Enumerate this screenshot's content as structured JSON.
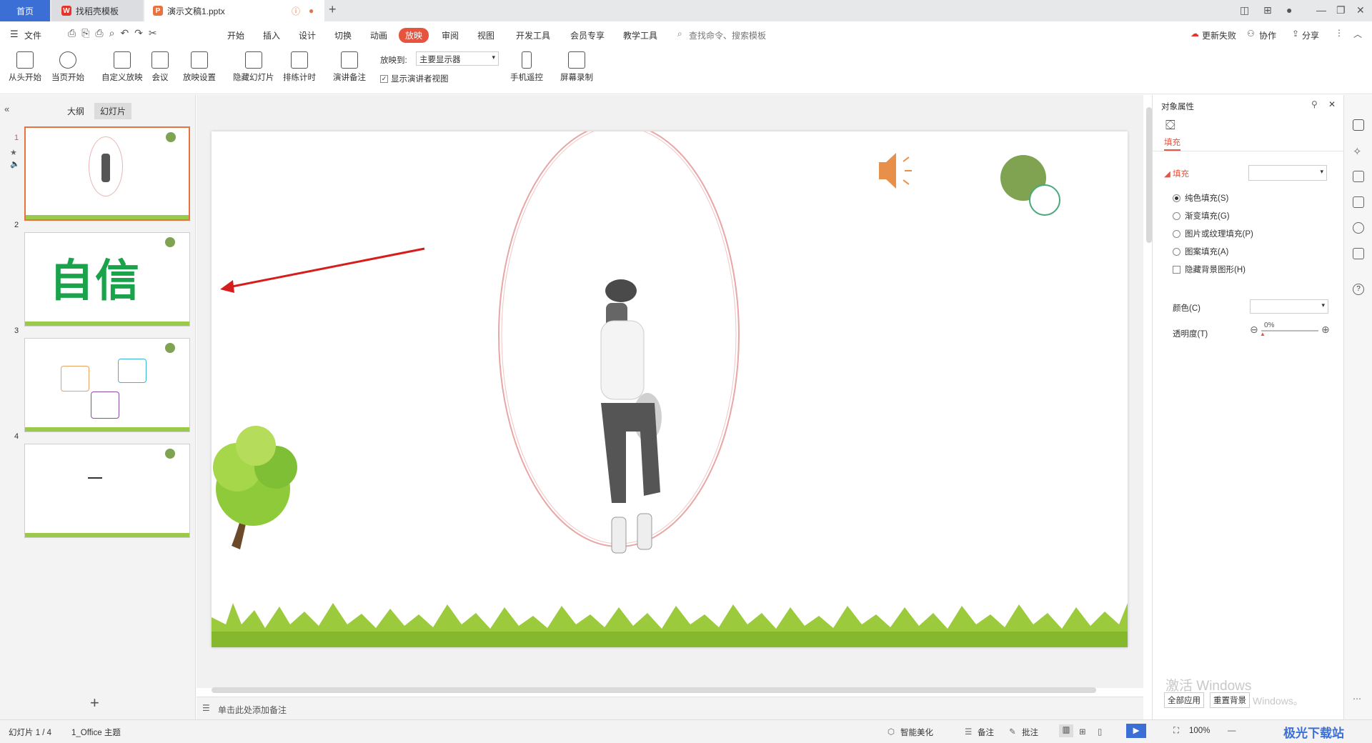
{
  "tabs": {
    "home": "首页",
    "template": "找稻壳模板",
    "document": "演示文稿1.pptx"
  },
  "menu": {
    "file": "文件",
    "items": [
      "开始",
      "插入",
      "设计",
      "切换",
      "动画",
      "放映",
      "审阅",
      "视图",
      "开发工具",
      "会员专享",
      "教学工具"
    ],
    "active": "放映",
    "search": "查找命令、搜索模板",
    "update": "更新失败",
    "collab": "协作",
    "share": "分享"
  },
  "ribbon": {
    "from_start": "从头开始",
    "from_current": "当页开始",
    "custom": "自定义放映",
    "meeting": "会议",
    "settings": "放映设置",
    "hide": "隐藏幻灯片",
    "rehearse": "排练计时",
    "notes": "演讲备注",
    "show_on": "放映到:",
    "monitor": "主要显示器",
    "presenter_view": "显示演讲者视图",
    "remote": "手机遥控",
    "record": "屏幕录制"
  },
  "panel": {
    "outline": "大纲",
    "slides": "幻灯片"
  },
  "thumbs": [
    {
      "num": "1",
      "text": ""
    },
    {
      "num": "2",
      "text": "自信"
    },
    {
      "num": "3",
      "text": ""
    },
    {
      "num": "4",
      "text": ""
    }
  ],
  "props": {
    "title": "对象属性",
    "fill_tab": "填充",
    "fill_section": "填充",
    "solid": "纯色填充(S)",
    "gradient": "渐变填充(G)",
    "picture": "图片或纹理填充(P)",
    "pattern": "图案填充(A)",
    "hide_bg": "隐藏背景图形(H)",
    "color": "颜色(C)",
    "transparency": "透明度(T)",
    "transparency_value": "0%",
    "apply_all": "全部应用",
    "reset_bg": "重置背景"
  },
  "watermark": {
    "line1": "激活 Windows",
    "line2": "Windows。"
  },
  "notes_placeholder": "单击此处添加备注",
  "status": {
    "slide": "幻灯片 1 / 4",
    "theme": "1_Office 主题",
    "beautify": "智能美化",
    "notes": "备注",
    "comment": "批注",
    "zoom": "100%"
  },
  "brand": "极光下载站",
  "colors": {
    "accent": "#e8533e",
    "green": "#7fa351",
    "red_arrow": "#d61c1c"
  }
}
